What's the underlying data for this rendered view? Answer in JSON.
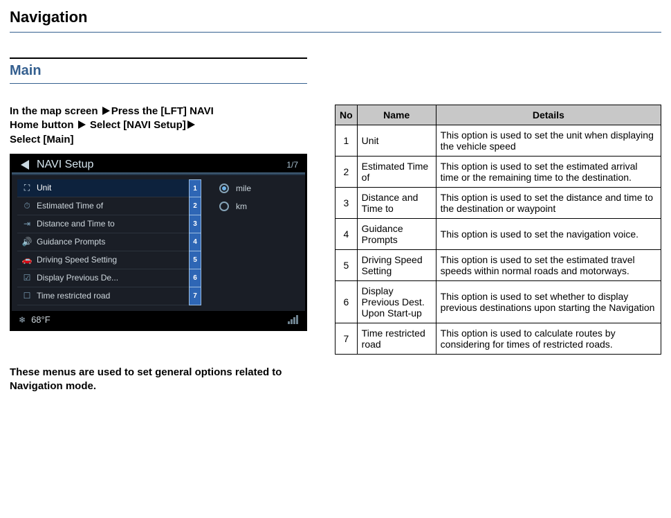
{
  "page_title": "Navigation",
  "section_title": "Main",
  "instruction": {
    "p1_a": "In the map screen",
    "p1_b": "Press the [LFT] NAVI",
    "p2_a": "Home button",
    "p2_b": "Select [NAVI Setup]",
    "p3": "Select [Main]"
  },
  "device": {
    "title": "NAVI Setup",
    "page_indicator": "1/7",
    "menu_items": [
      {
        "label": "Unit",
        "selected": true,
        "callout": "1",
        "icon": "⛶"
      },
      {
        "label": "Estimated Time of",
        "selected": false,
        "callout": "2",
        "icon": "⏱"
      },
      {
        "label": "Distance and Time to",
        "selected": false,
        "callout": "3",
        "icon": "⇥"
      },
      {
        "label": "Guidance Prompts",
        "selected": false,
        "callout": "4",
        "icon": "🔊"
      },
      {
        "label": "Driving Speed Setting",
        "selected": false,
        "callout": "5",
        "icon": "🚗"
      },
      {
        "label": "Display Previous De...",
        "selected": false,
        "callout": "6",
        "icon": "☑"
      },
      {
        "label": "Time restricted road",
        "selected": false,
        "callout": "7",
        "icon": "☐"
      }
    ],
    "radio_options": [
      {
        "label": "mile",
        "checked": true
      },
      {
        "label": "km",
        "checked": false
      }
    ],
    "temperature": "68°F",
    "temp_icon": "❄"
  },
  "left_description": "These menus are used to set general options related to Navigation mode.",
  "table": {
    "headers": {
      "no": "No",
      "name": "Name",
      "details": "Details"
    },
    "rows": [
      {
        "no": "1",
        "name": "Unit",
        "details": "This option is used to set the unit when displaying the vehicle speed"
      },
      {
        "no": "2",
        "name": "Estimated Time of",
        "details": "This option is used to set the estimated arrival time or the remaining time to the destination."
      },
      {
        "no": "3",
        "name": "Distance and Time to",
        "details": "This option is used to set the distance and time to the destination or waypoint"
      },
      {
        "no": "4",
        "name": "Guidance Prompts",
        "details": "This option is used to set the navigation voice."
      },
      {
        "no": "5",
        "name": "Driving Speed Setting",
        "details": "This option is used to set the estimated travel speeds within normal roads and motorways."
      },
      {
        "no": "6",
        "name": "Display Previous Dest. Upon Start-up",
        "details": "This option is used to set whether to display previous destinations upon starting the Navigation"
      },
      {
        "no": "7",
        "name": "Time restricted road",
        "details": "This option is used to calculate routes by considering for times of restricted roads."
      }
    ]
  }
}
